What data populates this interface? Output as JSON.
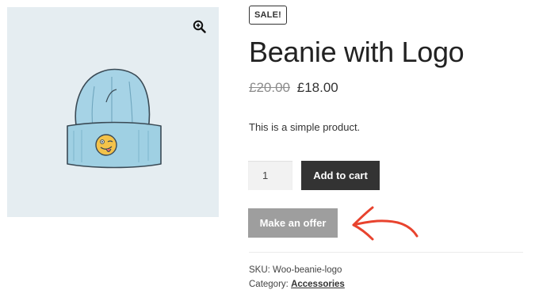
{
  "product": {
    "badge": "SALE!",
    "title": "Beanie with Logo",
    "price_old": "£20.00",
    "price_new": "£18.00",
    "description": "This is a simple product.",
    "quantity": "1",
    "add_to_cart_label": "Add to cart",
    "make_offer_label": "Make an offer",
    "sku_label": "SKU:",
    "sku_value": "Woo-beanie-logo",
    "category_label": "Category:",
    "category_value": "Accessories"
  },
  "gallery": {
    "zoom_icon": "magnifier-plus-icon",
    "image": "beanie-with-logo"
  },
  "colors": {
    "gallery_bg": "#e5edf1",
    "add_to_cart_bg": "#333333",
    "make_offer_bg": "#9e9e9e",
    "annotation_arrow": "#e8432e",
    "beanie": "#9fd0e3"
  }
}
